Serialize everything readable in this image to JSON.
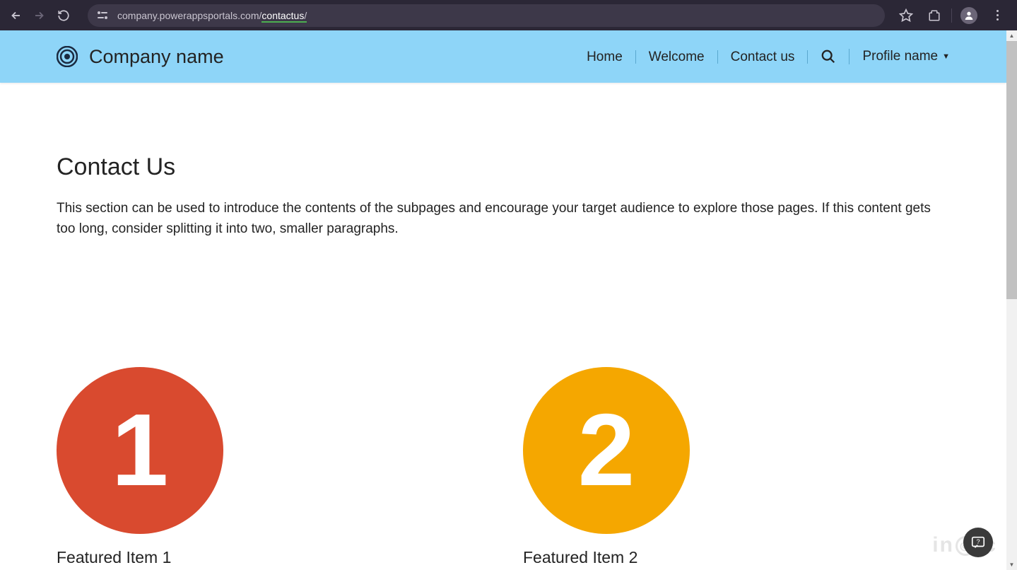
{
  "browser": {
    "url_domain": "company.powerappsportals.com/",
    "url_path": "contactus",
    "url_trailing": "/"
  },
  "header": {
    "brand": "Company name",
    "nav": {
      "home": "Home",
      "welcome": "Welcome",
      "contact": "Contact us",
      "profile": "Profile name"
    }
  },
  "main": {
    "title": "Contact Us",
    "description": "This section can be used to introduce the contents of the subpages and encourage your target audience to explore those pages. If this content gets too long, consider splitting it into two, smaller paragraphs."
  },
  "featured": {
    "items": [
      {
        "number": "1",
        "title": "Featured Item 1",
        "color": "red"
      },
      {
        "number": "2",
        "title": "Featured Item 2",
        "color": "orange"
      }
    ]
  },
  "watermark": "inogic"
}
